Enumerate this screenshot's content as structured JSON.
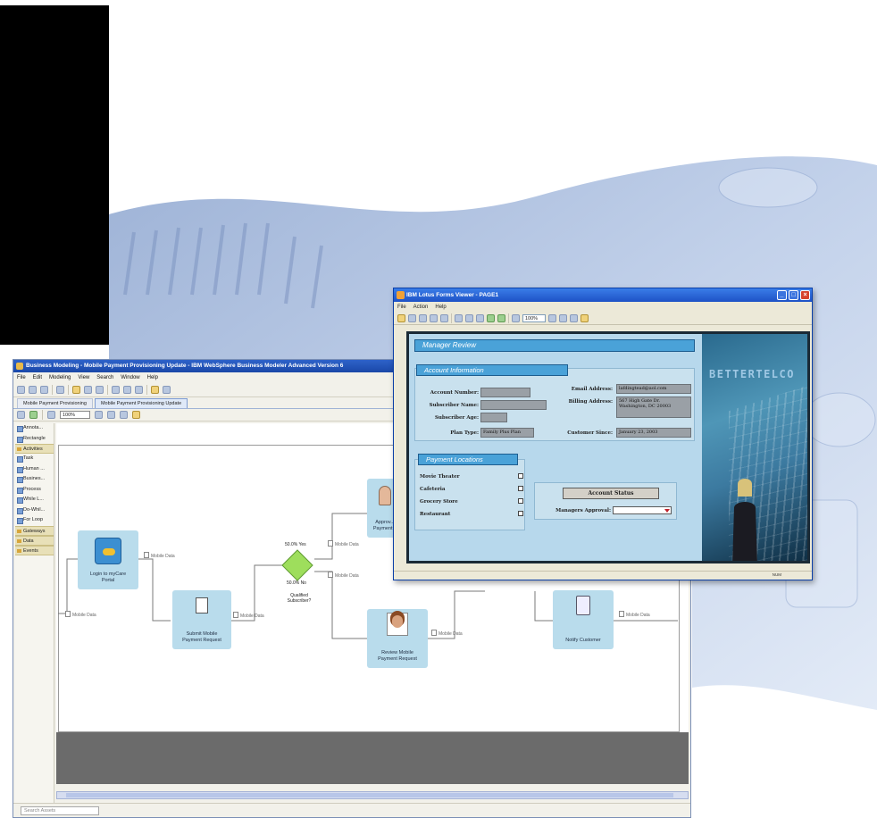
{
  "modeler": {
    "title": "Business Modeling - Mobile Payment Provisioning Update - IBM WebSphere Business Modeler Advanced Version 6",
    "menu": [
      "File",
      "Edit",
      "Modeling",
      "View",
      "Search",
      "Window",
      "Help"
    ],
    "tabs": [
      "Mobile Payment Provisioning",
      "Mobile Payment Provisioning Update"
    ],
    "zoom": "100%",
    "palette": {
      "items_top": [
        "Annota...",
        "Rectangle"
      ],
      "group_activities": "Activities",
      "items_activities": [
        "Task",
        "Human ...",
        "Busines...",
        "Process"
      ],
      "items_loops": [
        "While L...",
        "Do-Whil...",
        "For Loop"
      ],
      "group_gateways": "Gateways",
      "group_data": "Data",
      "group_events": "Events"
    },
    "nodes": {
      "login": "Login to myCare Portal",
      "submit": "Submit Mobile Payment Request",
      "approve": "Approv... Payment...",
      "review": "Review Mobile Payment Request",
      "notify": "Notify Customer"
    },
    "data_label": "Mobile Data",
    "gateway": {
      "yes": "50.0% Yes",
      "no": "50.0% No",
      "question": "Qualified Subscriber?"
    },
    "search_placeholder": "Search Assets"
  },
  "forms": {
    "title": "IBM Lotus Forms Viewer - PAGE1",
    "menu": [
      "File",
      "Action",
      "Help"
    ],
    "zoom": "100%",
    "manager_review": "Manager Review",
    "account_information": "Account Information",
    "labels": {
      "account_number": "Account Number:",
      "subscriber_name": "Subscriber Name:",
      "subscriber_age": "Subscriber Age:",
      "email_address": "Email Address:",
      "billing_address": "Billing Address:",
      "plan_type": "Plan Type:",
      "customer_since": "Customer Since:"
    },
    "values": {
      "email": "lafdingtead@aol.com",
      "billing": "567 High Gate Dr. Washington, DC 20003",
      "plan": "Family Plus Plan",
      "since": "January 23, 2003"
    },
    "payment_locations": "Payment Locations",
    "locations": [
      "Movie Theater",
      "Cafeteria",
      "Grocery Store",
      "Restaurant"
    ],
    "account_status_button": "Account Status",
    "managers_approval": "Managers Approval:",
    "brand": "BETTERTELCO",
    "status_num": "NUM"
  },
  "colors": {
    "titlebar_blue": "#1e52c6",
    "form_section_blue": "#4aa2d8",
    "node_fill": "#b9dcec"
  }
}
